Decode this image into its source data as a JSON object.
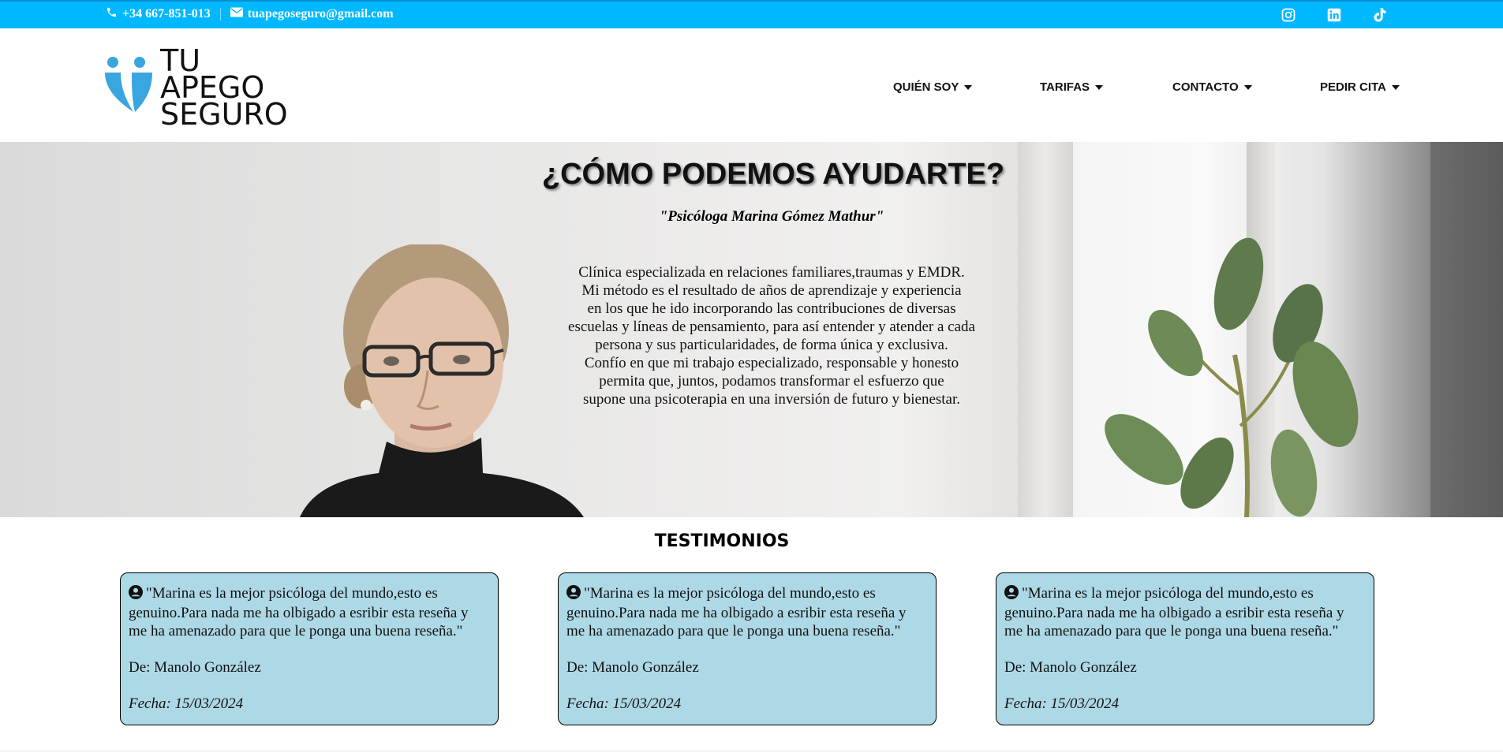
{
  "topbar": {
    "phone": "+34 667-851-013",
    "email": "tuapegoseguro@gmail.com",
    "social_icons": [
      "instagram-icon",
      "linkedin-icon",
      "tiktok-icon"
    ],
    "background_color": "#00b8ff"
  },
  "header": {
    "logo_lines": [
      "TU",
      "APEGO",
      "SEGURO"
    ],
    "logo_color": "#3aa6e0",
    "nav": [
      {
        "label": "QUIÉN SOY"
      },
      {
        "label": "TARIFAS"
      },
      {
        "label": "CONTACTO"
      },
      {
        "label": "PEDIR CITA"
      }
    ]
  },
  "hero": {
    "title": "¿CÓMO PODEMOS AYUDARTE?",
    "quote": "\"Psicóloga Marina Gómez Mathur\"",
    "description_lines": [
      "Clínica especializada en relaciones familiares,traumas y EMDR.",
      "Mi método es el resultado de años de aprendizaje y experiencia",
      "en los que he ido incorporando las contribuciones de diversas",
      "escuelas y líneas de pensamiento, para así entender y atender a cada",
      "persona y sus particularidades, de forma única y exclusiva.",
      "Confío en que mi trabajo especializado, responsable y honesto",
      "permita que, juntos, podamos transformar el esfuerzo que",
      "supone una psicoterapia en una inversión de futuro y bienestar."
    ]
  },
  "testimonials": {
    "title": "TESTIMONIOS",
    "card_color": "#add8e6",
    "items": [
      {
        "text": "\"Marina es la mejor psicóloga del mundo,esto es genuino.Para nada me ha olbigado a esribir esta reseña y me ha amenazado para que le ponga una buena reseña.\"",
        "author": "De: Manolo González",
        "date": "Fecha: 15/03/2024"
      },
      {
        "text": "\"Marina es la mejor psicóloga del mundo,esto es genuino.Para nada me ha olbigado a esribir esta reseña y me ha amenazado para que le ponga una buena reseña.\"",
        "author": "De: Manolo González",
        "date": "Fecha: 15/03/2024"
      },
      {
        "text": "\"Marina es la mejor psicóloga del mundo,esto es genuino.Para nada me ha olbigado a esribir esta reseña y me ha amenazado para que le ponga una buena reseña.\"",
        "author": "De: Manolo González",
        "date": "Fecha: 15/03/2024"
      }
    ]
  }
}
